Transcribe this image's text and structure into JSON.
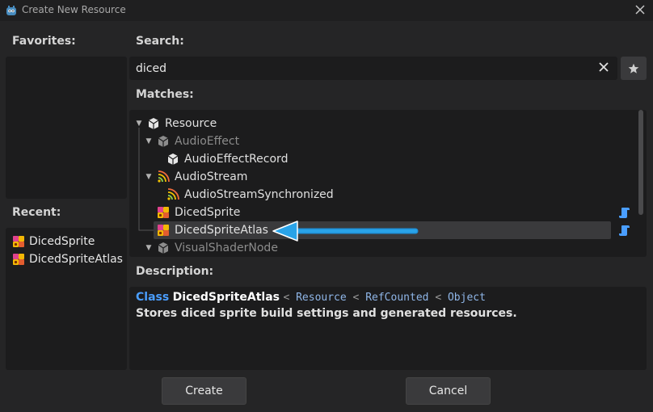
{
  "window": {
    "title": "Create New Resource"
  },
  "favorites": {
    "heading": "Favorites:"
  },
  "recent": {
    "heading": "Recent:",
    "items": [
      {
        "label": "DicedSprite",
        "icon": "diced-sprite-icon"
      },
      {
        "label": "DicedSpriteAtlas",
        "icon": "diced-sprite-icon"
      }
    ]
  },
  "search": {
    "heading": "Search:",
    "value": "diced"
  },
  "matches": {
    "heading": "Matches:",
    "tree": [
      {
        "label": "Resource",
        "icon": "cube-icon",
        "expanded": true,
        "dim": false
      },
      {
        "label": "AudioEffect",
        "icon": "cube-icon",
        "expanded": true,
        "dim": true
      },
      {
        "label": "AudioEffectRecord",
        "icon": "cube-icon",
        "dim": false
      },
      {
        "label": "AudioStream",
        "icon": "audio-stream-icon",
        "expanded": true,
        "dim": false
      },
      {
        "label": "AudioStreamSynchronized",
        "icon": "audio-stream-icon",
        "dim": false
      },
      {
        "label": "DicedSprite",
        "icon": "diced-sprite-icon",
        "dim": false,
        "script": true
      },
      {
        "label": "DicedSpriteAtlas",
        "icon": "diced-sprite-icon",
        "dim": false,
        "script": true,
        "selected": true
      },
      {
        "label": "VisualShaderNode",
        "icon": "cube-icon",
        "expanded": true,
        "dim": true
      }
    ]
  },
  "description": {
    "heading": "Description:",
    "keyword": "Class",
    "class_name": "DicedSpriteAtlas",
    "inheritance": [
      "Resource",
      "RefCounted",
      "Object"
    ],
    "text": "Stores diced sprite build settings and generated resources."
  },
  "buttons": {
    "create": "Create",
    "cancel": "Cancel"
  },
  "colors": {
    "accent": "#4a9eff",
    "arrow": "#29a3e8",
    "background": "#252526",
    "panel": "#1c1c1d"
  }
}
